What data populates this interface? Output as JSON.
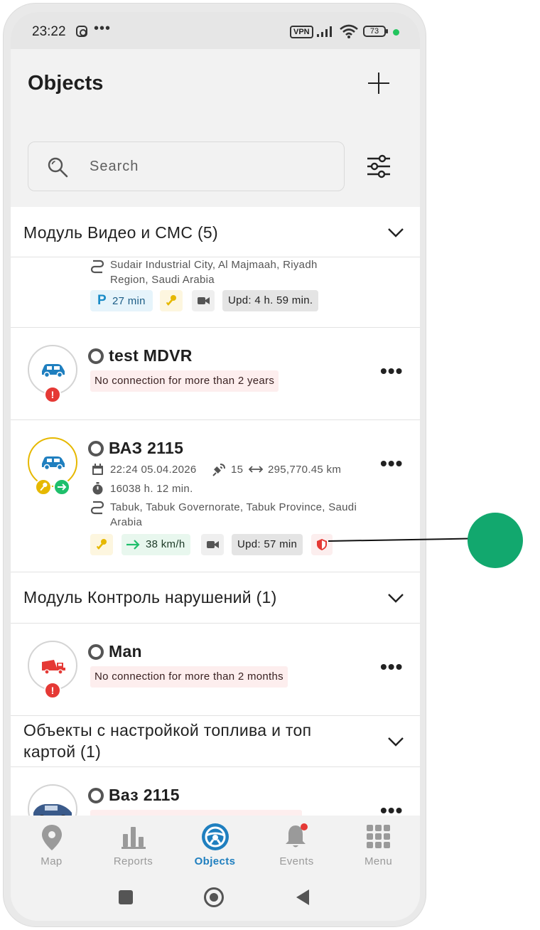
{
  "status_bar": {
    "time": "23:22",
    "dots": "•••",
    "vpn": "VPN",
    "battery": "73"
  },
  "header": {
    "title": "Objects"
  },
  "search": {
    "placeholder": "Search"
  },
  "groups": [
    {
      "title": "Модуль Видео и СМС (5)"
    },
    {
      "title": "Модуль Контроль нарушений (1)"
    },
    {
      "title": "Объекты  с настройкой топлива и топ картой (1)"
    }
  ],
  "partial_card": {
    "address": "Sudair Industrial City, Al Majmaah, Riyadh Region, Saudi Arabia",
    "parking_letter": "P",
    "parking": "27 min",
    "updated": "Upd: 4 h. 59 min."
  },
  "objects": [
    {
      "name": "test MDVR",
      "warning": "No connection for more than 2 years",
      "badge": "!"
    },
    {
      "name": "ВАЗ 2115",
      "datetime": "22:24 05.04.2026",
      "satellites": "15",
      "mileage": "295,770.45 km",
      "engine_hours": "16038 h. 12 min.",
      "address": "Tabuk, Tabuk Governorate, Tabuk Province, Saudi Arabia",
      "speed": "38 km/h",
      "updated": "Upd: 57 min"
    },
    {
      "name": "Man",
      "warning": "No connection for more than 2 months",
      "badge": "!"
    },
    {
      "name": "Ваз 2115"
    }
  ],
  "tabs": [
    {
      "label": "Map",
      "icon": "map-pin-icon"
    },
    {
      "label": "Reports",
      "icon": "bar-chart-icon"
    },
    {
      "label": "Objects",
      "icon": "steering-wheel-icon",
      "active": true
    },
    {
      "label": "Events",
      "icon": "bell-icon"
    },
    {
      "label": "Menu",
      "icon": "grid-icon"
    }
  ],
  "colors": {
    "accent": "#1f7fbf",
    "callout": "#12a86e",
    "danger": "#e53935",
    "ignition": "#e6b800",
    "moving": "#1fbf6b"
  }
}
